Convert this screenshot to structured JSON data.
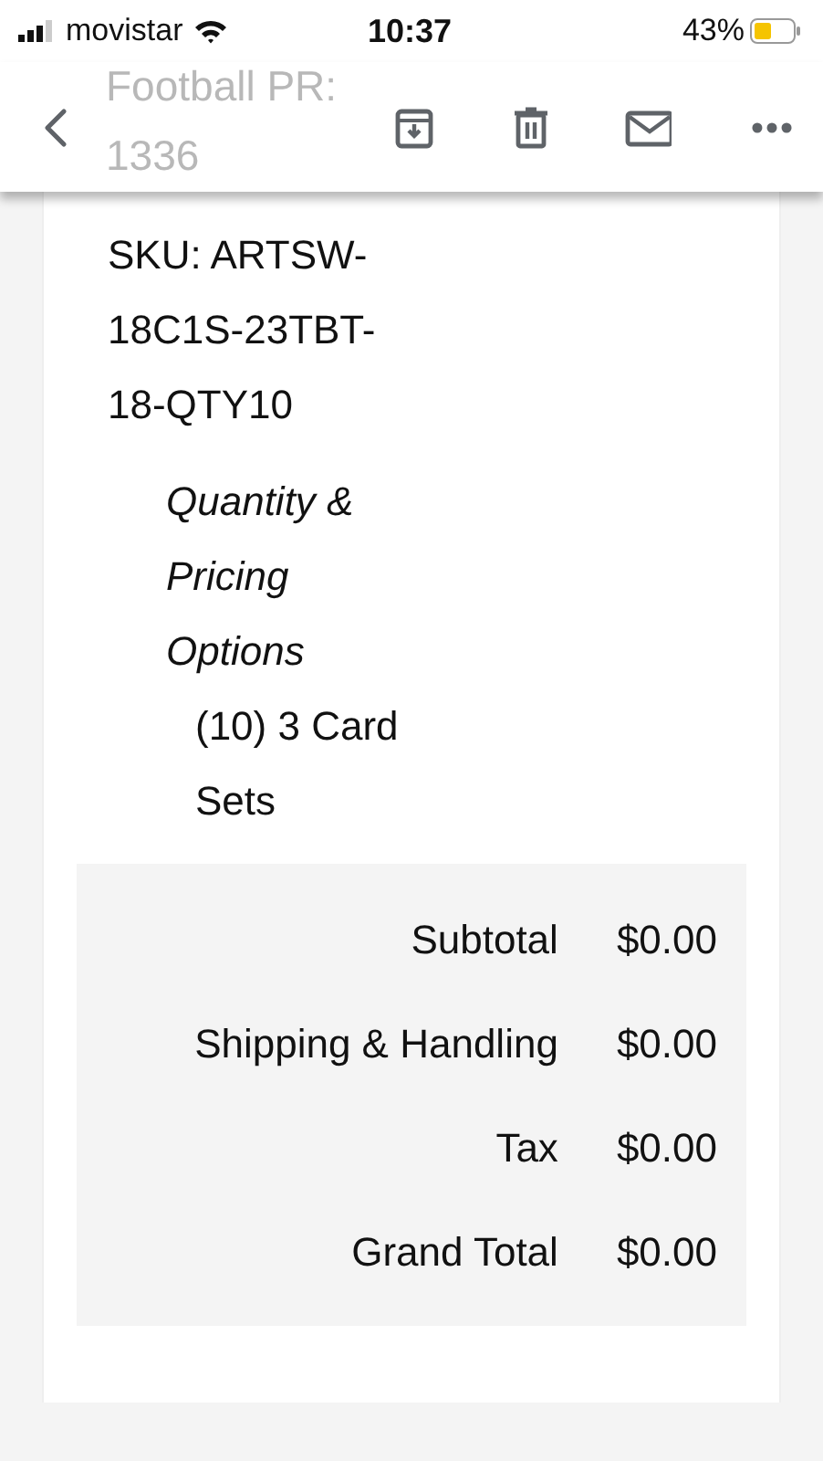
{
  "status_bar": {
    "carrier": "movistar",
    "time": "10:37",
    "battery": "43%"
  },
  "background_title": [
    "Football PR:",
    "1336"
  ],
  "toolbar": [
    {
      "kind": "back"
    },
    {
      "kind": "archive"
    },
    {
      "kind": "delete"
    },
    {
      "kind": "mail"
    },
    {
      "kind": "more"
    }
  ],
  "item": {
    "sku": "SKU: ARTSW-18C1S-23TBT-18-QTY10",
    "option_label": "Quantity & Pricing Options",
    "option_value": "(10) 3 Card Sets"
  },
  "totals": [
    {
      "label": "Subtotal",
      "value": "$0.00"
    },
    {
      "label": "Shipping & Handling",
      "value": "$0.00"
    },
    {
      "label": "Tax",
      "value": "$0.00"
    },
    {
      "label": "Grand Total",
      "value": "$0.00"
    }
  ]
}
